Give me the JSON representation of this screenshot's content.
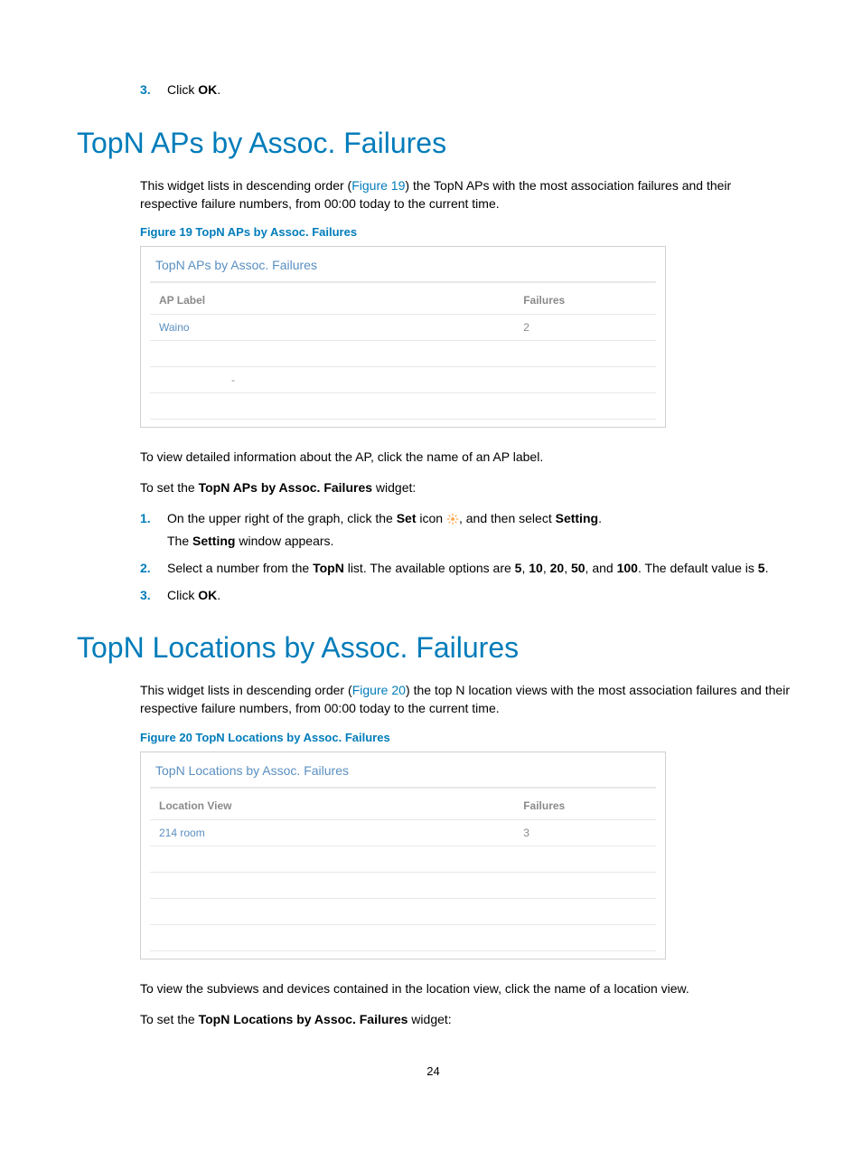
{
  "step0": {
    "num": "3.",
    "text_a": "Click ",
    "text_b": "OK",
    "text_c": "."
  },
  "section1": {
    "heading": "TopN APs by Assoc. Failures",
    "intro_a": "This widget lists in descending order (",
    "intro_link": "Figure 19",
    "intro_b": ") the TopN APs with the most association failures and their respective failure numbers, from 00:00 today to the current time.",
    "figcap": "Figure 19 TopN APs by Assoc. Failures",
    "widget_title": "TopN APs by Assoc. Failures",
    "col1": "AP Label",
    "col2": "Failures",
    "row1_label": "Waino",
    "row1_val": "2",
    "row3_label": "-",
    "after1": "To view detailed information about the AP, click the name of an AP label.",
    "after2_a": "To set the ",
    "after2_b": "TopN APs by Assoc. Failures",
    "after2_c": " widget:",
    "s1": {
      "num": "1.",
      "a": "On the upper right of the graph, click the ",
      "b": "Set",
      "c": " icon ",
      "d": ", and then select ",
      "e": "Setting",
      "f": ".",
      "l2a": "The ",
      "l2b": "Setting",
      "l2c": " window appears."
    },
    "s2": {
      "num": "2.",
      "a": "Select a number from the ",
      "b": "TopN",
      "c": " list. The available options are ",
      "d": "5",
      "e": ", ",
      "f": "10",
      "g": "20",
      "h": "50",
      "i": ", and ",
      "j": "100",
      "k": ". The default value is ",
      "l": "5",
      "m": "."
    },
    "s3": {
      "num": "3.",
      "a": "Click ",
      "b": "OK",
      "c": "."
    }
  },
  "section2": {
    "heading": "TopN Locations by Assoc. Failures",
    "intro_a": "This widget lists in descending order (",
    "intro_link": "Figure 20",
    "intro_b": ") the top N location views with the most association failures and their respective failure numbers, from 00:00 today to the current time.",
    "figcap": "Figure 20 TopN Locations by Assoc. Failures",
    "widget_title": "TopN Locations by Assoc. Failures",
    "col1": "Location View",
    "col2": "Failures",
    "row1_label": "214 room",
    "row1_val": "3",
    "after1": "To view the subviews and devices contained in the location view, click the name of a location view.",
    "after2_a": "To set the ",
    "after2_b": "TopN Locations by Assoc. Failures",
    "after2_c": " widget:"
  },
  "page_number": "24"
}
